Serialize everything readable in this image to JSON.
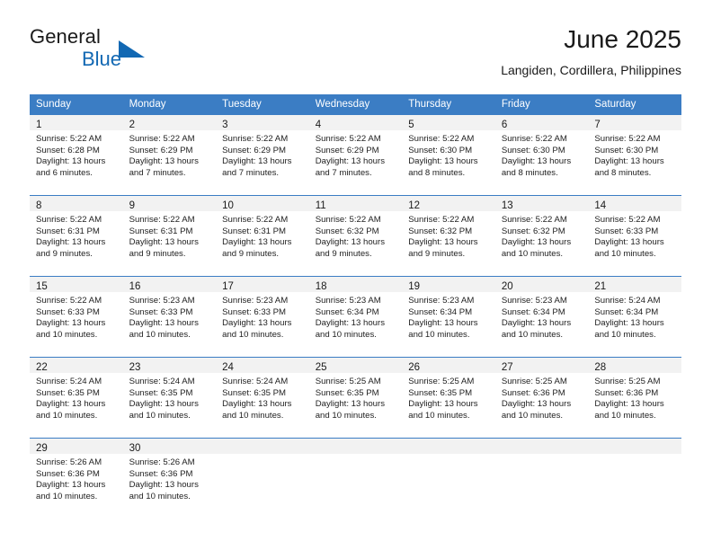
{
  "brand": {
    "name_part1": "General",
    "name_part2": "Blue",
    "triangle_color": "#1268b3"
  },
  "header": {
    "title": "June 2025",
    "subtitle": "Langiden, Cordillera, Philippines"
  },
  "calendar": {
    "accent_color": "#3b7dc4",
    "daynum_band_color": "#f2f2f2",
    "weekday_headers": [
      "Sunday",
      "Monday",
      "Tuesday",
      "Wednesday",
      "Thursday",
      "Friday",
      "Saturday"
    ],
    "weeks": [
      [
        {
          "day": "1",
          "sunrise": "Sunrise: 5:22 AM",
          "sunset": "Sunset: 6:28 PM",
          "daylight1": "Daylight: 13 hours",
          "daylight2": "and 6 minutes."
        },
        {
          "day": "2",
          "sunrise": "Sunrise: 5:22 AM",
          "sunset": "Sunset: 6:29 PM",
          "daylight1": "Daylight: 13 hours",
          "daylight2": "and 7 minutes."
        },
        {
          "day": "3",
          "sunrise": "Sunrise: 5:22 AM",
          "sunset": "Sunset: 6:29 PM",
          "daylight1": "Daylight: 13 hours",
          "daylight2": "and 7 minutes."
        },
        {
          "day": "4",
          "sunrise": "Sunrise: 5:22 AM",
          "sunset": "Sunset: 6:29 PM",
          "daylight1": "Daylight: 13 hours",
          "daylight2": "and 7 minutes."
        },
        {
          "day": "5",
          "sunrise": "Sunrise: 5:22 AM",
          "sunset": "Sunset: 6:30 PM",
          "daylight1": "Daylight: 13 hours",
          "daylight2": "and 8 minutes."
        },
        {
          "day": "6",
          "sunrise": "Sunrise: 5:22 AM",
          "sunset": "Sunset: 6:30 PM",
          "daylight1": "Daylight: 13 hours",
          "daylight2": "and 8 minutes."
        },
        {
          "day": "7",
          "sunrise": "Sunrise: 5:22 AM",
          "sunset": "Sunset: 6:30 PM",
          "daylight1": "Daylight: 13 hours",
          "daylight2": "and 8 minutes."
        }
      ],
      [
        {
          "day": "8",
          "sunrise": "Sunrise: 5:22 AM",
          "sunset": "Sunset: 6:31 PM",
          "daylight1": "Daylight: 13 hours",
          "daylight2": "and 9 minutes."
        },
        {
          "day": "9",
          "sunrise": "Sunrise: 5:22 AM",
          "sunset": "Sunset: 6:31 PM",
          "daylight1": "Daylight: 13 hours",
          "daylight2": "and 9 minutes."
        },
        {
          "day": "10",
          "sunrise": "Sunrise: 5:22 AM",
          "sunset": "Sunset: 6:31 PM",
          "daylight1": "Daylight: 13 hours",
          "daylight2": "and 9 minutes."
        },
        {
          "day": "11",
          "sunrise": "Sunrise: 5:22 AM",
          "sunset": "Sunset: 6:32 PM",
          "daylight1": "Daylight: 13 hours",
          "daylight2": "and 9 minutes."
        },
        {
          "day": "12",
          "sunrise": "Sunrise: 5:22 AM",
          "sunset": "Sunset: 6:32 PM",
          "daylight1": "Daylight: 13 hours",
          "daylight2": "and 9 minutes."
        },
        {
          "day": "13",
          "sunrise": "Sunrise: 5:22 AM",
          "sunset": "Sunset: 6:32 PM",
          "daylight1": "Daylight: 13 hours",
          "daylight2": "and 10 minutes."
        },
        {
          "day": "14",
          "sunrise": "Sunrise: 5:22 AM",
          "sunset": "Sunset: 6:33 PM",
          "daylight1": "Daylight: 13 hours",
          "daylight2": "and 10 minutes."
        }
      ],
      [
        {
          "day": "15",
          "sunrise": "Sunrise: 5:22 AM",
          "sunset": "Sunset: 6:33 PM",
          "daylight1": "Daylight: 13 hours",
          "daylight2": "and 10 minutes."
        },
        {
          "day": "16",
          "sunrise": "Sunrise: 5:23 AM",
          "sunset": "Sunset: 6:33 PM",
          "daylight1": "Daylight: 13 hours",
          "daylight2": "and 10 minutes."
        },
        {
          "day": "17",
          "sunrise": "Sunrise: 5:23 AM",
          "sunset": "Sunset: 6:33 PM",
          "daylight1": "Daylight: 13 hours",
          "daylight2": "and 10 minutes."
        },
        {
          "day": "18",
          "sunrise": "Sunrise: 5:23 AM",
          "sunset": "Sunset: 6:34 PM",
          "daylight1": "Daylight: 13 hours",
          "daylight2": "and 10 minutes."
        },
        {
          "day": "19",
          "sunrise": "Sunrise: 5:23 AM",
          "sunset": "Sunset: 6:34 PM",
          "daylight1": "Daylight: 13 hours",
          "daylight2": "and 10 minutes."
        },
        {
          "day": "20",
          "sunrise": "Sunrise: 5:23 AM",
          "sunset": "Sunset: 6:34 PM",
          "daylight1": "Daylight: 13 hours",
          "daylight2": "and 10 minutes."
        },
        {
          "day": "21",
          "sunrise": "Sunrise: 5:24 AM",
          "sunset": "Sunset: 6:34 PM",
          "daylight1": "Daylight: 13 hours",
          "daylight2": "and 10 minutes."
        }
      ],
      [
        {
          "day": "22",
          "sunrise": "Sunrise: 5:24 AM",
          "sunset": "Sunset: 6:35 PM",
          "daylight1": "Daylight: 13 hours",
          "daylight2": "and 10 minutes."
        },
        {
          "day": "23",
          "sunrise": "Sunrise: 5:24 AM",
          "sunset": "Sunset: 6:35 PM",
          "daylight1": "Daylight: 13 hours",
          "daylight2": "and 10 minutes."
        },
        {
          "day": "24",
          "sunrise": "Sunrise: 5:24 AM",
          "sunset": "Sunset: 6:35 PM",
          "daylight1": "Daylight: 13 hours",
          "daylight2": "and 10 minutes."
        },
        {
          "day": "25",
          "sunrise": "Sunrise: 5:25 AM",
          "sunset": "Sunset: 6:35 PM",
          "daylight1": "Daylight: 13 hours",
          "daylight2": "and 10 minutes."
        },
        {
          "day": "26",
          "sunrise": "Sunrise: 5:25 AM",
          "sunset": "Sunset: 6:35 PM",
          "daylight1": "Daylight: 13 hours",
          "daylight2": "and 10 minutes."
        },
        {
          "day": "27",
          "sunrise": "Sunrise: 5:25 AM",
          "sunset": "Sunset: 6:36 PM",
          "daylight1": "Daylight: 13 hours",
          "daylight2": "and 10 minutes."
        },
        {
          "day": "28",
          "sunrise": "Sunrise: 5:25 AM",
          "sunset": "Sunset: 6:36 PM",
          "daylight1": "Daylight: 13 hours",
          "daylight2": "and 10 minutes."
        }
      ],
      [
        {
          "day": "29",
          "sunrise": "Sunrise: 5:26 AM",
          "sunset": "Sunset: 6:36 PM",
          "daylight1": "Daylight: 13 hours",
          "daylight2": "and 10 minutes."
        },
        {
          "day": "30",
          "sunrise": "Sunrise: 5:26 AM",
          "sunset": "Sunset: 6:36 PM",
          "daylight1": "Daylight: 13 hours",
          "daylight2": "and 10 minutes."
        },
        {
          "day": "",
          "sunrise": "",
          "sunset": "",
          "daylight1": "",
          "daylight2": ""
        },
        {
          "day": "",
          "sunrise": "",
          "sunset": "",
          "daylight1": "",
          "daylight2": ""
        },
        {
          "day": "",
          "sunrise": "",
          "sunset": "",
          "daylight1": "",
          "daylight2": ""
        },
        {
          "day": "",
          "sunrise": "",
          "sunset": "",
          "daylight1": "",
          "daylight2": ""
        },
        {
          "day": "",
          "sunrise": "",
          "sunset": "",
          "daylight1": "",
          "daylight2": ""
        }
      ]
    ]
  }
}
